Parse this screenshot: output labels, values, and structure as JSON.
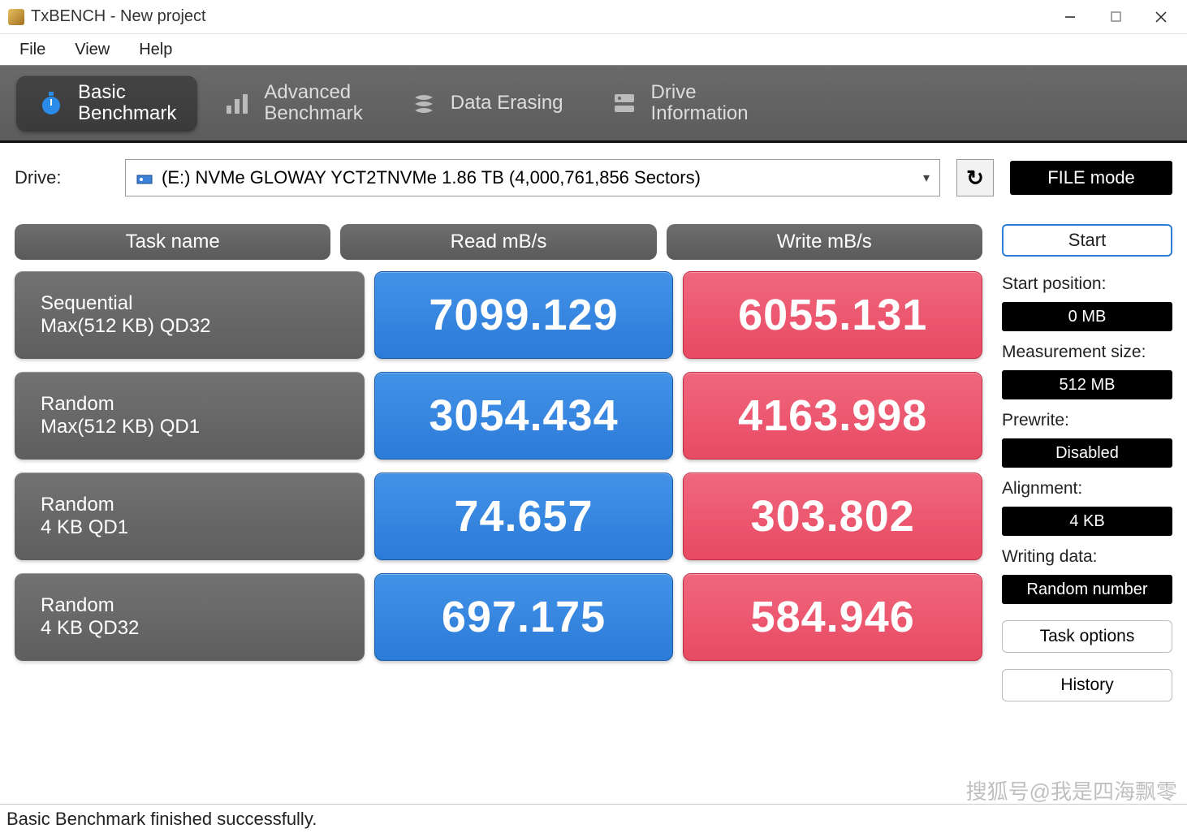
{
  "window": {
    "title": "TxBENCH - New project"
  },
  "menu": {
    "file": "File",
    "view": "View",
    "help": "Help"
  },
  "tabs": {
    "basic": "Basic\nBenchmark",
    "advanced": "Advanced\nBenchmark",
    "erase": "Data Erasing",
    "info": "Drive\nInformation"
  },
  "drive": {
    "label": "Drive:",
    "selected": "(E:) NVMe GLOWAY YCT2TNVMe  1.86 TB (4,000,761,856 Sectors)"
  },
  "mode_button": "FILE mode",
  "headers": {
    "task": "Task name",
    "read": "Read mB/s",
    "write": "Write mB/s"
  },
  "rows": [
    {
      "name1": "Sequential",
      "name2": "Max(512 KB) QD32",
      "read": "7099.129",
      "write": "6055.131"
    },
    {
      "name1": "Random",
      "name2": "Max(512 KB) QD1",
      "read": "3054.434",
      "write": "4163.998"
    },
    {
      "name1": "Random",
      "name2": "4 KB QD1",
      "read": "74.657",
      "write": "303.802"
    },
    {
      "name1": "Random",
      "name2": "4 KB QD32",
      "read": "697.175",
      "write": "584.946"
    }
  ],
  "side": {
    "start": "Start",
    "start_pos_label": "Start position:",
    "start_pos_value": "0 MB",
    "measure_label": "Measurement size:",
    "measure_value": "512 MB",
    "prewrite_label": "Prewrite:",
    "prewrite_value": "Disabled",
    "align_label": "Alignment:",
    "align_value": "4 KB",
    "writing_label": "Writing data:",
    "writing_value": "Random number",
    "task_options": "Task options",
    "history": "History"
  },
  "status": "Basic Benchmark finished successfully.",
  "watermark": "搜狐号@我是四海飘零"
}
